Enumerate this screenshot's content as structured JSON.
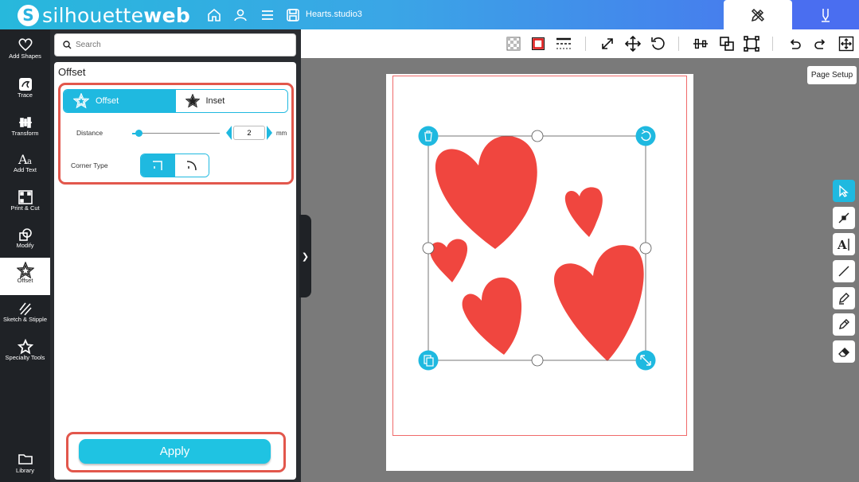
{
  "app": {
    "logo_light": "silhouette",
    "logo_bold": "web",
    "filename": "Hearts.studio3"
  },
  "topbar_icons": [
    "home-icon",
    "account-icon",
    "menu-icon",
    "save-icon"
  ],
  "mode_tabs": [
    {
      "name": "design",
      "icon": "pencil-ruler-icon",
      "active": true
    },
    {
      "name": "send",
      "icon": "blade-icon",
      "active": false
    }
  ],
  "nav": [
    {
      "label": "Add Shapes",
      "icon": "heart-outline-icon"
    },
    {
      "label": "Trace",
      "icon": "trace-icon"
    },
    {
      "label": "Transform",
      "icon": "transform-icon"
    },
    {
      "label": "Add Text",
      "icon": "text-icon"
    },
    {
      "label": "Print & Cut",
      "icon": "print-cut-icon"
    },
    {
      "label": "Modify",
      "icon": "modify-icon"
    },
    {
      "label": "Offset",
      "icon": "star-offset-icon",
      "active": true
    },
    {
      "label": "Sketch & Stipple",
      "icon": "sketch-icon"
    },
    {
      "label": "Specialty Tools",
      "icon": "star-icon"
    },
    {
      "label": "Library",
      "icon": "folder-icon"
    }
  ],
  "search": {
    "placeholder": "Search",
    "value": ""
  },
  "panel": {
    "title": "Offset",
    "mode_options": [
      "Offset",
      "Inset"
    ],
    "selected_mode": "Offset",
    "distance_label": "Distance",
    "distance_value": "2",
    "distance_unit": "mm",
    "corner_type_label": "Corner Type",
    "corner_types": [
      "sharp",
      "round"
    ],
    "selected_corner": "sharp",
    "apply_label": "Apply"
  },
  "page_setup_label": "Page Setup",
  "right_tools": [
    "select-icon",
    "node-edit-icon",
    "text-cursor-icon",
    "line-icon",
    "pen-icon",
    "pencil-icon",
    "eraser-icon"
  ],
  "colors": {
    "accent": "#1fb9e0",
    "heart": "#f0463f",
    "highlight": "#e2574c",
    "nav_bg": "#1f2226"
  }
}
